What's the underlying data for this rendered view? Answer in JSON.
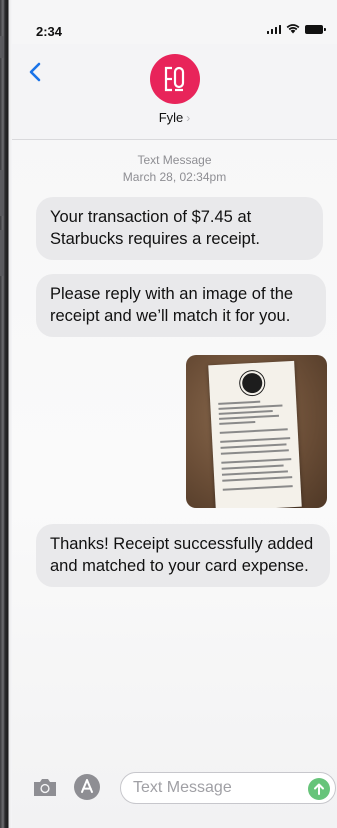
{
  "status_bar": {
    "time": "2:34"
  },
  "header": {
    "contact_name": "Fyle",
    "avatar_icon": "fyle-logo-icon",
    "avatar_color": "#e8245a",
    "back_icon": "chevron-left-icon"
  },
  "meta": {
    "label": "Text Message",
    "timestamp": "March 28, 02:34pm"
  },
  "messages": [
    {
      "type": "received",
      "text": "Your transaction of $7.45 at Starbucks requires a receipt."
    },
    {
      "type": "received",
      "text": "Please reply with an image of the receipt and we’ll match it for you."
    },
    {
      "type": "sent-image",
      "icon": "receipt-photo"
    },
    {
      "type": "received",
      "text": "Thanks! Receipt successfully added and matched to your card expense."
    }
  ],
  "composer": {
    "camera_icon": "camera-icon",
    "apps_icon": "app-store-icon",
    "placeholder": "Text Message",
    "send_icon": "arrow-up-icon",
    "send_color": "#67c47a"
  }
}
